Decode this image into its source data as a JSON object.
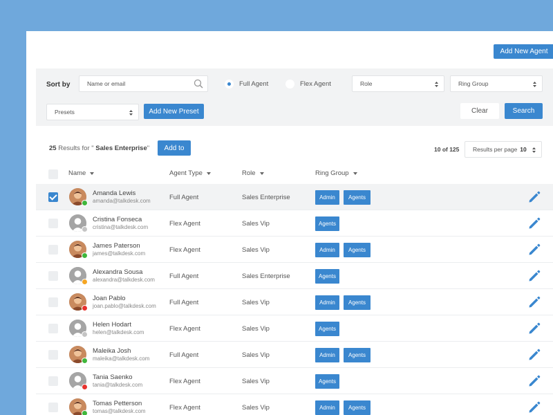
{
  "header": {
    "add_agent_label": "Add New Agent"
  },
  "filters": {
    "sort_by_label": "Sort by",
    "search_placeholder": "Name or email",
    "radio_full": "Full Agent",
    "radio_flex": "Flex Agent",
    "role_select": "Role",
    "ring_group_select": "Ring Group",
    "presets_select": "Presets",
    "add_preset_label": "Add New Preset",
    "clear_label": "Clear",
    "search_label": "Search"
  },
  "results": {
    "count": "25",
    "text_pre": " Results for \" ",
    "query": "Sales Enterprise",
    "text_post": "\"",
    "add_to_label": "Add to",
    "pager": "10 of 125",
    "per_page_label": "Results per page",
    "per_page_value": "10"
  },
  "columns": {
    "name": "Name",
    "agent_type": "Agent Type",
    "role": "Role",
    "ring_group": "Ring Group"
  },
  "colors": {
    "accent": "#3a87cf",
    "online": "#3fb63b",
    "away": "#f5a623",
    "busy": "#e8322e",
    "offline": "#c4c4c4"
  },
  "rows": [
    {
      "name": "Amanda Lewis",
      "email": "amanda@talkdesk.com",
      "agent_type": "Full Agent",
      "role": "Sales Enterprise",
      "tags": [
        "Admin",
        "Agents"
      ],
      "status_color": "#3fb63b",
      "avatar": "photo",
      "selected": true
    },
    {
      "name": "Cristina Fonseca",
      "email": "cristina@talkdesk.com",
      "agent_type": "Flex Agent",
      "role": "Sales Vip",
      "tags": [
        "Agents"
      ],
      "status_color": "#c4c4c4",
      "avatar": "placeholder",
      "selected": false
    },
    {
      "name": "James Paterson",
      "email": "james@talkdesk.com",
      "agent_type": "Flex Agent",
      "role": "Sales Vip",
      "tags": [
        "Admin",
        "Agents"
      ],
      "status_color": "#3fb63b",
      "avatar": "photo",
      "selected": false
    },
    {
      "name": "Alexandra Sousa",
      "email": "alexandra@talkdesk.com",
      "agent_type": "Full Agent",
      "role": "Sales Enterprise",
      "tags": [
        "Agents"
      ],
      "status_color": "#f5a623",
      "avatar": "placeholder",
      "selected": false
    },
    {
      "name": "Joan Pablo",
      "email": "joan.pablo@talkdesk.com",
      "agent_type": "Full Agent",
      "role": "Sales Vip",
      "tags": [
        "Admin",
        "Agents"
      ],
      "status_color": "#e8322e",
      "avatar": "photo",
      "selected": false
    },
    {
      "name": "Helen Hodart",
      "email": "helen@talkdesk.com",
      "agent_type": "Flex Agent",
      "role": "Sales Vip",
      "tags": [
        "Agents"
      ],
      "status_color": "#c4c4c4",
      "avatar": "placeholder",
      "selected": false
    },
    {
      "name": "Maleika Josh",
      "email": "maleika@talkdesk.com",
      "agent_type": "Full Agent",
      "role": "Sales Vip",
      "tags": [
        "Admin",
        "Agents"
      ],
      "status_color": "#3fb63b",
      "avatar": "photo",
      "selected": false
    },
    {
      "name": "Tania Saenko",
      "email": "tania@talkdesk.com",
      "agent_type": "Flex Agent",
      "role": "Sales Vip",
      "tags": [
        "Agents"
      ],
      "status_color": "#e8322e",
      "avatar": "placeholder",
      "selected": false
    },
    {
      "name": "Tomas Petterson",
      "email": "tomas@talkdesk.com",
      "agent_type": "Flex Agent",
      "role": "Sales Vip",
      "tags": [
        "Admin",
        "Agents"
      ],
      "status_color": "#3fb63b",
      "avatar": "photo",
      "selected": false
    }
  ]
}
